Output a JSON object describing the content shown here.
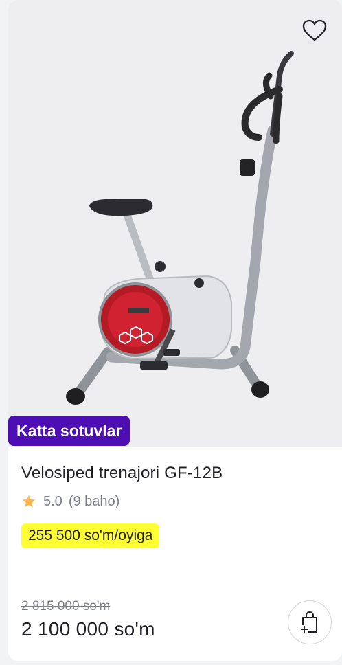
{
  "product": {
    "badge": "Katta sotuvlar",
    "title": "Velosiped trenajori GF-12B",
    "rating": "5.0",
    "reviews": "(9 baho)",
    "installment": "255 500 so'm/oyiga",
    "old_price": "2 815 000 so'm",
    "price": "2 100 000 so'm"
  },
  "icons": {
    "favorite": "heart-icon",
    "rating": "star-icon",
    "cart": "shopping-bag-plus-icon"
  },
  "colors": {
    "badge_bg": "#4d0fb4",
    "installment_bg": "#ffff33",
    "star": "#ffb54c"
  }
}
